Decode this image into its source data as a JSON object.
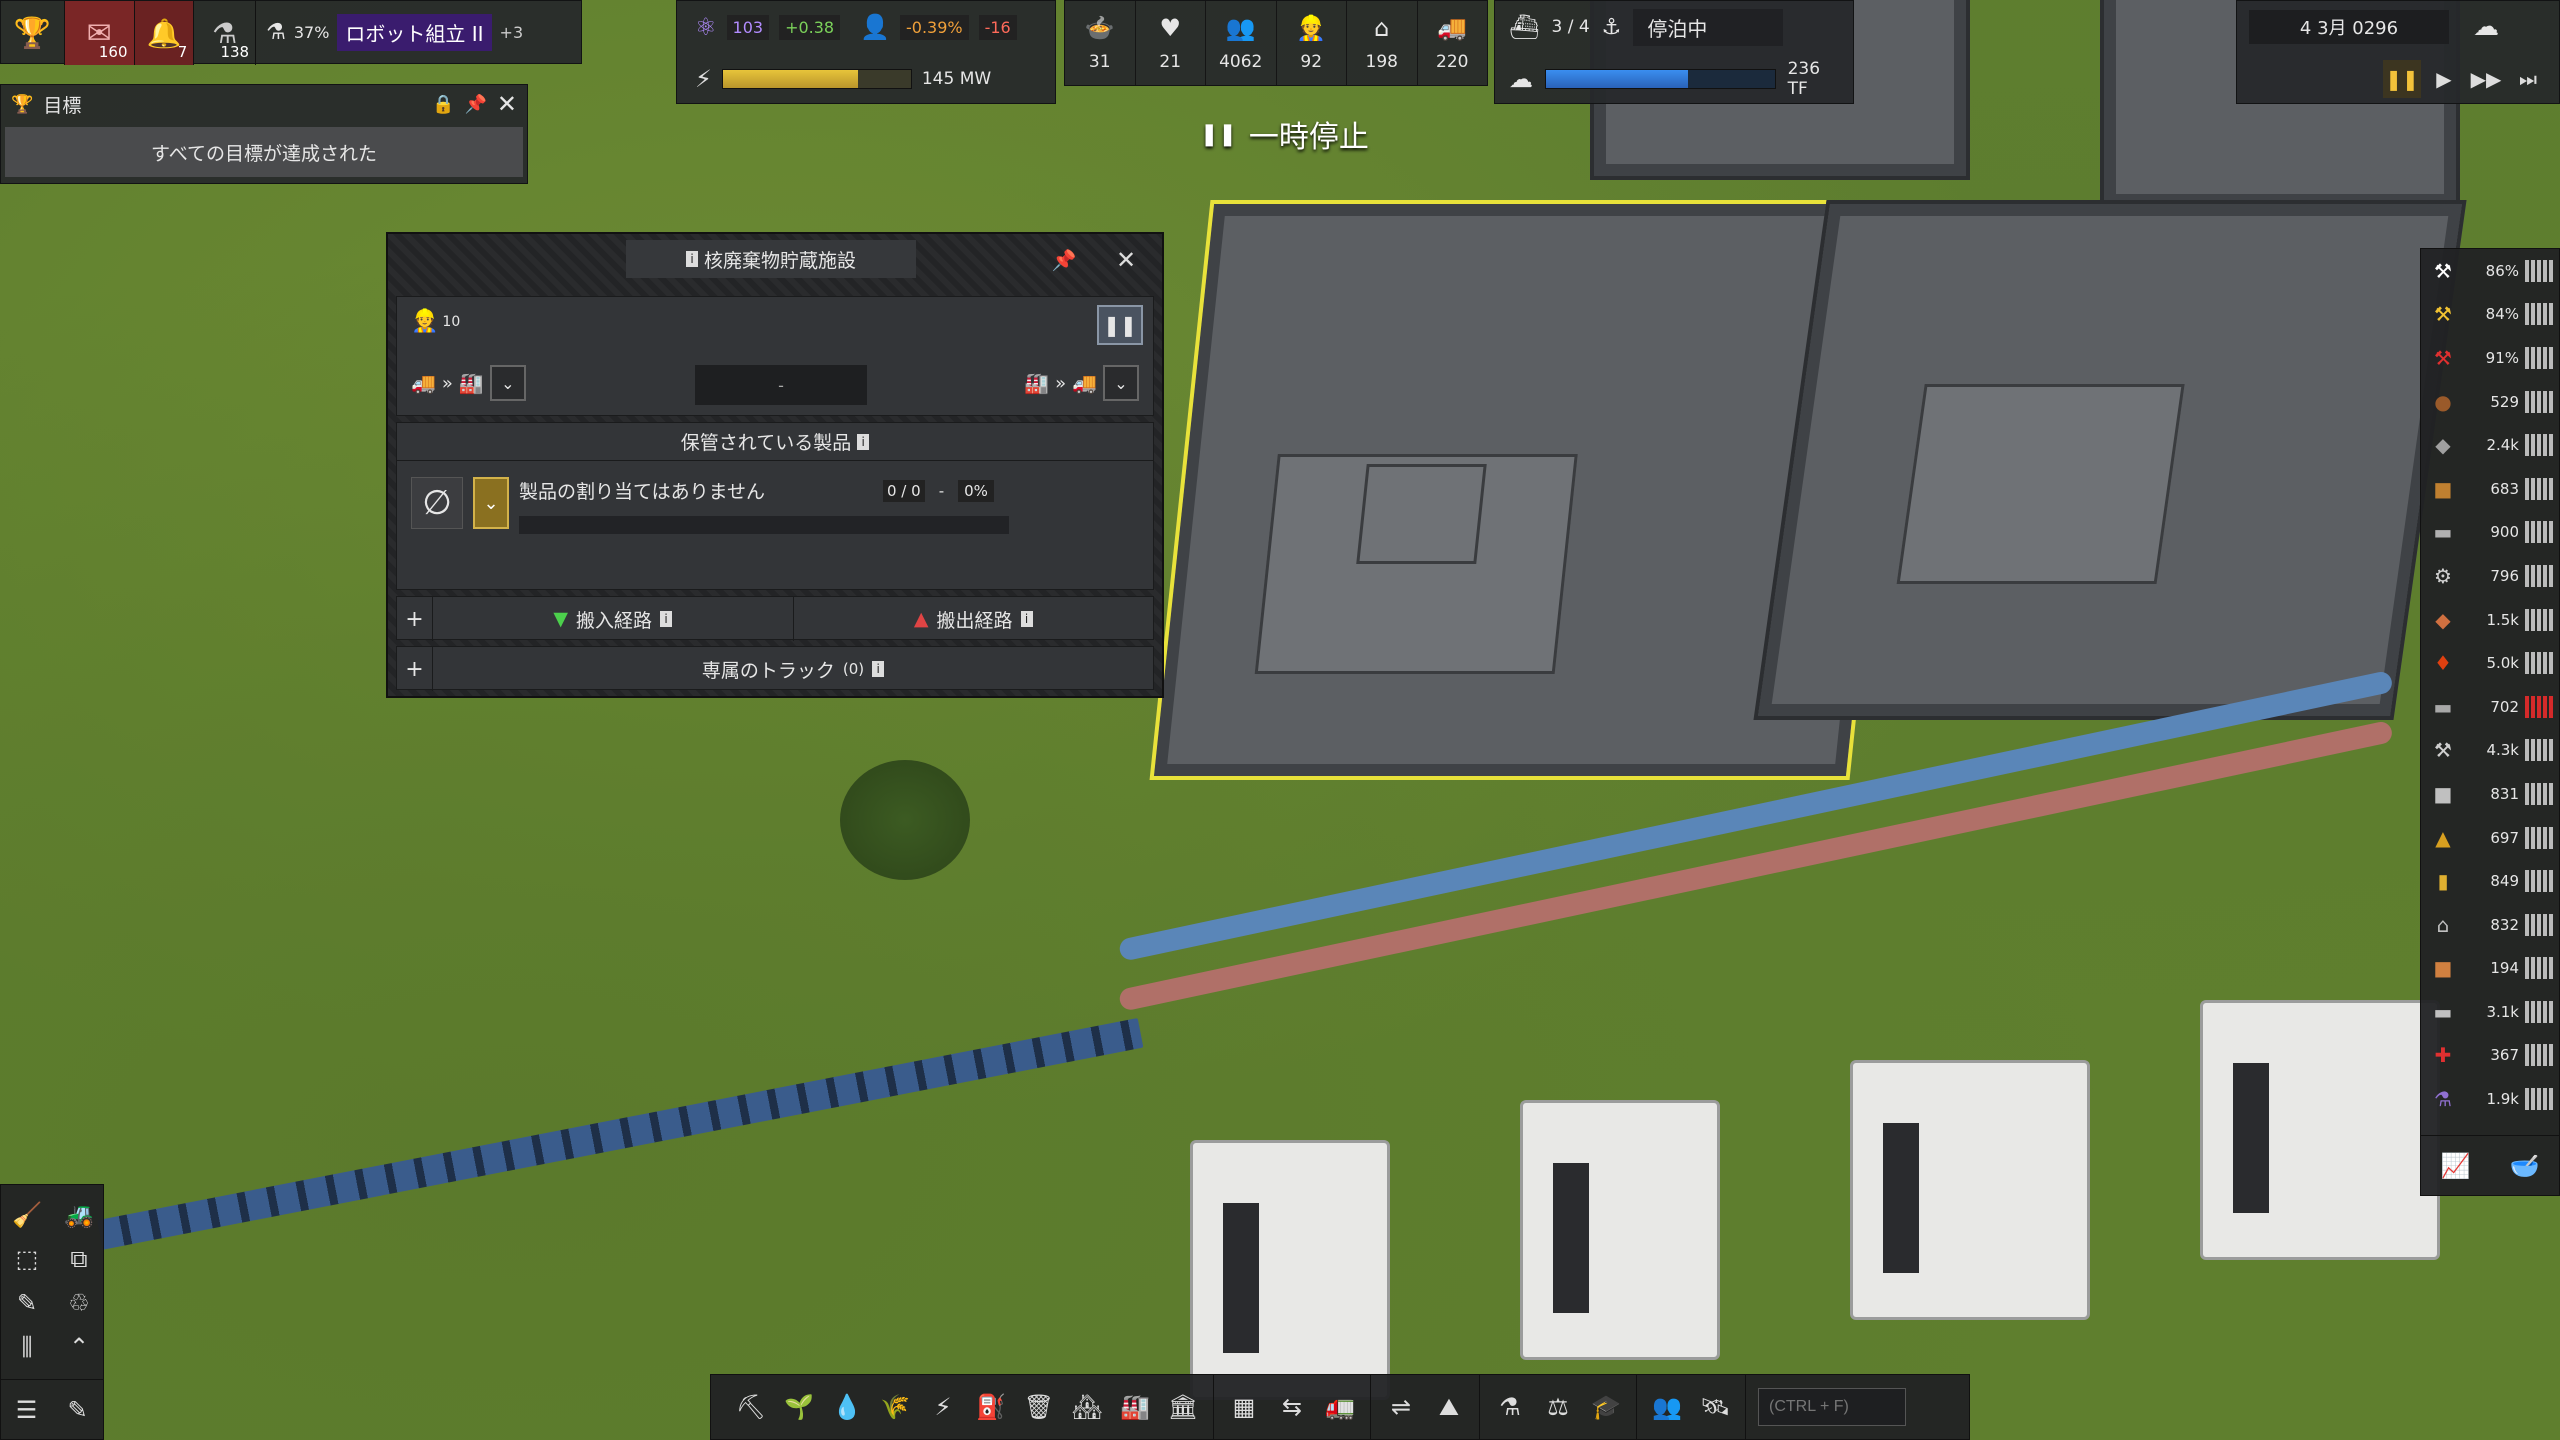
{
  "top_left": {
    "trophy_icon": "trophy-icon",
    "mail_count": "160",
    "alert_count": "7",
    "research_count": "138",
    "research_progress": "37%",
    "research_name": "ロボット組立 II",
    "research_queue": "+3"
  },
  "stats": {
    "unity": "103",
    "unity_change": "+0.38",
    "population_change_pct": "-0.39%",
    "population_change": "-16",
    "power": "145 MW",
    "power_fill": 0.72,
    "food": "31",
    "health": "21",
    "population": "4062",
    "workers": "92",
    "housing": "198",
    "vehicles": "220",
    "ships": "3 / 4",
    "ship_status": "停泊中",
    "water": "236 TF",
    "water_fill": 0.62
  },
  "time": {
    "date": "4 3月 0296",
    "paused_label": "一時停止"
  },
  "goals": {
    "title": "目標",
    "message": "すべての目標が達成された"
  },
  "dialog": {
    "title": "核廃棄物貯蔵施設",
    "workers": "10",
    "center_value": "-",
    "stored_header": "保管されている製品",
    "no_product": "製品の割り当てはありません",
    "quantity": "0 / 0",
    "dash": "-",
    "percent": "0%",
    "input_routes": "搬入経路",
    "output_routes": "搬出経路",
    "trucks": "専属のトラック",
    "trucks_count": "(0)"
  },
  "resources": [
    {
      "icon": "maintenance-1-icon",
      "value": "86%",
      "color": "#ffffff"
    },
    {
      "icon": "maintenance-2-icon",
      "value": "84%",
      "color": "#f1c232"
    },
    {
      "icon": "maintenance-3-icon",
      "value": "91%",
      "color": "#e03030"
    },
    {
      "icon": "wood-icon",
      "value": "529",
      "color": "#9a5a2a"
    },
    {
      "icon": "stone-icon",
      "value": "2.4k",
      "color": "#a0a0a0"
    },
    {
      "icon": "crate-icon",
      "value": "683",
      "color": "#c08030"
    },
    {
      "icon": "plate-icon",
      "value": "900",
      "color": "#b0b0b0"
    },
    {
      "icon": "construction-icon",
      "value": "796",
      "color": "#d0d0d0"
    },
    {
      "icon": "copper-icon",
      "value": "1.5k",
      "color": "#d07040"
    },
    {
      "icon": "fuel-icon",
      "value": "5.0k",
      "color": "#e04010"
    },
    {
      "icon": "steel-icon",
      "value": "702",
      "color": "#a8a8a8"
    },
    {
      "icon": "tools-icon",
      "value": "4.3k",
      "color": "#d0d0d0"
    },
    {
      "icon": "concrete-icon",
      "value": "831",
      "color": "#c0c0c0"
    },
    {
      "icon": "goods-icon",
      "value": "697",
      "color": "#d8a020"
    },
    {
      "icon": "gold-icon",
      "value": "849",
      "color": "#e0b030"
    },
    {
      "icon": "electronics-icon",
      "value": "832",
      "color": "#c0c0c0"
    },
    {
      "icon": "food-pack-icon",
      "value": "194",
      "color": "#d08040"
    },
    {
      "icon": "glass-icon",
      "value": "3.1k",
      "color": "#c0c0c0"
    },
    {
      "icon": "medical-icon",
      "value": "367",
      "color": "#e03030"
    },
    {
      "icon": "chemical-icon",
      "value": "1.9k",
      "color": "#9070d0"
    }
  ],
  "search": {
    "placeholder": "(CTRL + F)"
  }
}
